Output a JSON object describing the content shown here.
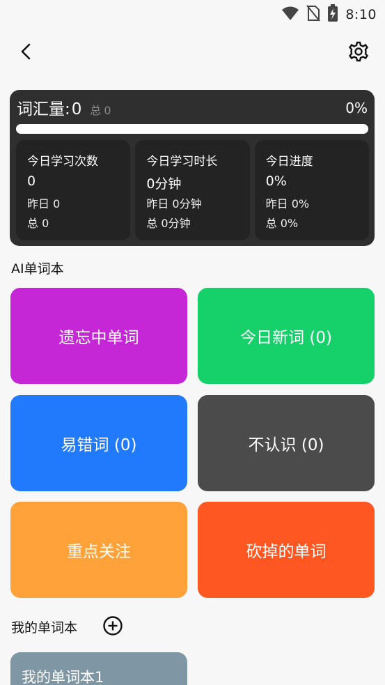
{
  "status_bar": {
    "time": "8:10",
    "icons": [
      "wifi-icon",
      "no-sim-icon",
      "battery-charging-icon"
    ]
  },
  "app_bar": {
    "back_icon": "chevron-left-icon",
    "settings_icon": "gear-icon"
  },
  "stats": {
    "vocab_label": "词汇量:",
    "vocab_value": "0",
    "total_label": "总",
    "total_value": "0",
    "percent": "0%",
    "progress_fraction": 0,
    "boxes": [
      {
        "title": "今日学习次数",
        "main": "0",
        "yesterday": "昨日 0",
        "total": "总 0"
      },
      {
        "title": "今日学习时长",
        "main": "0分钟",
        "yesterday": "昨日 0分钟",
        "total": "总 0分钟"
      },
      {
        "title": "今日进度",
        "main": "0%",
        "yesterday": "昨日 0%",
        "total": "总 0%"
      }
    ]
  },
  "ai_section": {
    "title": "AI单词本",
    "tiles": [
      {
        "label": "遗忘中单词",
        "color": "#c627d6"
      },
      {
        "label": "今日新词 (0)",
        "color": "#16d16a"
      },
      {
        "label": "易错词 (0)",
        "color": "#2179fb"
      },
      {
        "label": "不认识 (0)",
        "color": "#4b4b4b"
      },
      {
        "label": "重点关注",
        "color": "#ffa23a"
      },
      {
        "label": "砍掉的单词",
        "color": "#ff5722"
      }
    ]
  },
  "my_section": {
    "title": "我的单词本",
    "add_icon": "plus-circle-icon",
    "notebooks": [
      {
        "label": "我的单词本1",
        "color": "#7f96a4"
      }
    ]
  }
}
